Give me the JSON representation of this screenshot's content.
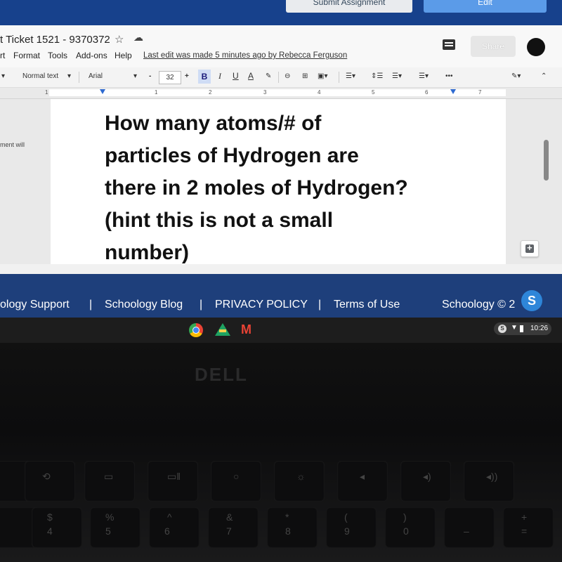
{
  "schoology_top": {
    "submit_label": "Submit Assignment",
    "edit_label": "Edit"
  },
  "docs": {
    "title": "t Ticket 1521 - 9370372",
    "menu": [
      "rt",
      "Format",
      "Tools",
      "Add-ons",
      "Help"
    ],
    "last_edit": "Last edit was made 5 minutes ago by Rebecca Ferguson",
    "share_label": "Share",
    "toolbar": {
      "style": "Normal text",
      "font": "Arial",
      "font_size": "32",
      "minus": "-",
      "plus": "+",
      "bold": "B",
      "italic": "I",
      "underline": "U",
      "text_color": "A",
      "more": "•••"
    },
    "ruler_numbers": [
      "1",
      "1",
      "2",
      "3",
      "4",
      "5",
      "6",
      "7"
    ],
    "side_note": "ment will",
    "question_lines": [
      "How many atoms/# of",
      "particles of Hydrogen are",
      "there in 2 moles of Hydrogen?",
      "(hint this is not a small",
      "number)"
    ]
  },
  "footer": {
    "links": [
      "ology Support",
      "Schoology Blog",
      "PRIVACY POLICY",
      "Terms of Use"
    ],
    "separator": "|",
    "copyright": "Schoology © 2",
    "badge": "S"
  },
  "taskbar": {
    "tray_s": "S",
    "time": "10:26"
  },
  "laptop": {
    "brand": "DELL",
    "keys": [
      {
        "top": "$",
        "bottom": "4"
      },
      {
        "top": "%",
        "bottom": "5"
      },
      {
        "top": "^",
        "bottom": "6"
      },
      {
        "top": "&",
        "bottom": "7"
      },
      {
        "top": "*",
        "bottom": "8"
      },
      {
        "top": "(",
        "bottom": "9"
      },
      {
        "top": ")",
        "bottom": "0"
      }
    ]
  },
  "colors": {
    "schoology_blue": "#17418c",
    "footer_blue": "#1e3f7b",
    "edit_button": "#5b9be8"
  }
}
